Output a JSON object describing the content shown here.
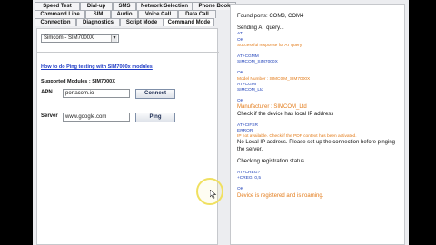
{
  "tabs": {
    "row1": [
      "Speed Test",
      "Dial-up",
      "SMS",
      "Network Selection",
      "Phone Book"
    ],
    "row2": [
      "Command Line",
      "SIM",
      "Audio",
      "Voice Call",
      "Data Call"
    ],
    "row3": [
      "Connection",
      "Diagnostics",
      "Script Mode",
      "Command Mode"
    ]
  },
  "left": {
    "model_select": "Simcom - SIM7000X",
    "howto_link": "How to do Ping testing with SIM7000x modules",
    "supported_modules": "Supported Modules : SIM7000X",
    "apn_label": "APN",
    "apn_value": "portacom.io",
    "connect_button": "Connect",
    "server_label": "Server",
    "server_value": "www.google.com",
    "ping_button": "Ping"
  },
  "console": {
    "lines": [
      {
        "t": "Found ports: COM3, COM4",
        "c": "black"
      },
      {
        "t": "",
        "c": "gap"
      },
      {
        "t": "Sending AT query...",
        "c": "black"
      },
      {
        "t": "AT",
        "c": "blue",
        "s": true
      },
      {
        "t": "OK",
        "c": "blue",
        "s": true
      },
      {
        "t": "Successful response for AT query.",
        "c": "orange",
        "s": true
      },
      {
        "t": "",
        "c": "gap"
      },
      {
        "t": "AT+CGMM",
        "c": "blue",
        "s": true
      },
      {
        "t": "SIMCOM_SIM7000X",
        "c": "blue",
        "s": true
      },
      {
        "t": "",
        "c": "gap"
      },
      {
        "t": "OK",
        "c": "blue",
        "s": true
      },
      {
        "t": "Model Number : SIMCOM_SIM7000X",
        "c": "orange",
        "s": true
      },
      {
        "t": "AT+CGMI",
        "c": "blue",
        "s": true
      },
      {
        "t": "SIMCOM_Ltd",
        "c": "blue",
        "s": true
      },
      {
        "t": "",
        "c": "gap"
      },
      {
        "t": "OK",
        "c": "blue",
        "s": true
      },
      {
        "t": "Manufacturer : SIMCOM_Ltd",
        "c": "orange"
      },
      {
        "t": "Check if the device has local IP address",
        "c": "black"
      },
      {
        "t": "",
        "c": "gap"
      },
      {
        "t": "AT+CIFSR",
        "c": "blue",
        "s": true
      },
      {
        "t": "ERROR",
        "c": "blue",
        "s": true
      },
      {
        "t": "IP not available. Check if the PDP context has been activated.",
        "c": "orange",
        "s": true
      },
      {
        "t": "No Local IP address. Please set up the connection before pinging",
        "c": "black"
      },
      {
        "t": "the server.",
        "c": "black"
      },
      {
        "t": "",
        "c": "gap"
      },
      {
        "t": "Checking registration status...",
        "c": "black"
      },
      {
        "t": "",
        "c": "gap"
      },
      {
        "t": "AT+CREG?",
        "c": "blue",
        "s": true
      },
      {
        "t": "+CREG: 0,5",
        "c": "blue",
        "s": true
      },
      {
        "t": "",
        "c": "gap"
      },
      {
        "t": "OK",
        "c": "blue",
        "s": true
      },
      {
        "t": "Device is registered and is roaming.",
        "c": "orange"
      }
    ]
  },
  "colors": {
    "link": "#1f3cc6",
    "console_command": "#1d3fb8",
    "console_status": "#e37a17",
    "cursor_ring": "#f0e060"
  }
}
